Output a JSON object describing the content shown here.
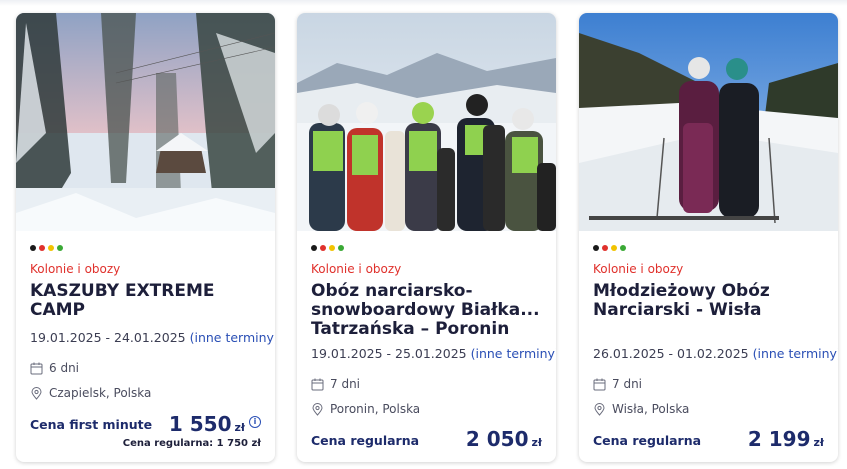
{
  "cards": [
    {
      "image_alt": "snowy forest cabin",
      "category": "Kolonie i obozy",
      "title": "KASZUBY EXTREME CAMP",
      "dates": "19.01.2025 - 24.01.2025",
      "more_dates": "(inne terminy)",
      "duration": "6 dni",
      "location": "Czapielsk, Polska",
      "price_label": "Cena first minute",
      "price": "1 550",
      "currency": "zł",
      "regular_price": "Cena regularna: 1 750 zł"
    },
    {
      "image_alt": "group of snowboarders on mountain",
      "category": "Kolonie i obozy",
      "title": "Obóz narciarsko-snowboardowy Białka... Tatrzańska – Poronin",
      "dates": "19.01.2025 - 25.01.2025",
      "more_dates": "(inne terminy)",
      "duration": "7 dni",
      "location": "Poronin, Polska",
      "price_label": "Cena regularna",
      "price": "2 050",
      "currency": "zł"
    },
    {
      "image_alt": "two skiers on slope",
      "category": "Kolonie i obozy",
      "title": "Młodzieżowy Obóz Narciarski - Wisła",
      "dates": "26.01.2025 - 01.02.2025",
      "more_dates": "(inne terminy)",
      "duration": "7 dni",
      "location": "Wisła, Polska",
      "price_label": "Cena regularna",
      "price": "2 199",
      "currency": "zł"
    }
  ],
  "dot_colors": [
    "#1a1a1a",
    "#e0312c",
    "#f2c300",
    "#3aa935"
  ],
  "info_icon_glyph": "i"
}
